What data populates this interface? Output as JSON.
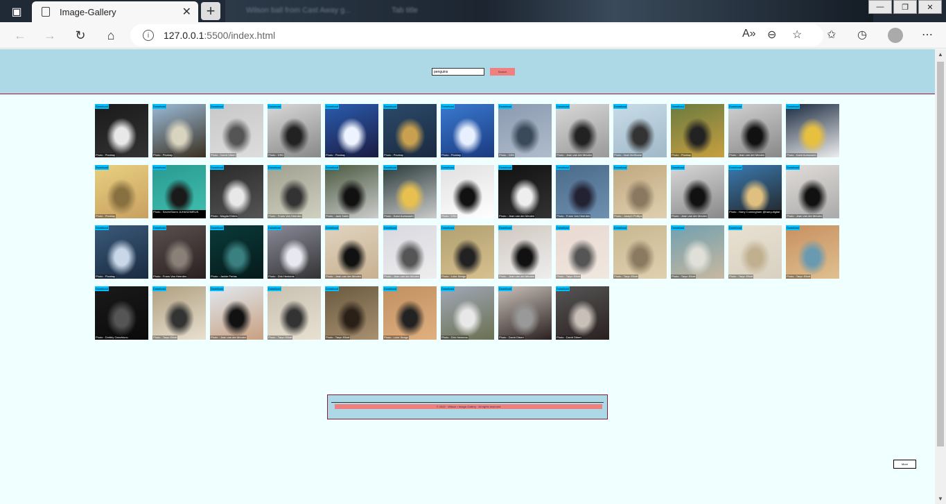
{
  "browser": {
    "tab_title": "Image-Gallery",
    "tab_close": "✕",
    "new_tab": "+",
    "bg_tab_1": "Wilson ball from Cast Away g...",
    "bg_tab_2": "Tab title",
    "url_host": "127.0.0.1",
    "url_path": ":5500/index.html",
    "win_min": "—",
    "win_max": "❐",
    "win_close": "✕"
  },
  "search": {
    "value": "penguins",
    "button_label": "Search"
  },
  "images": [
    {
      "download": "Download",
      "credit": "Photo : Pixabay",
      "colors": [
        "#1a1a1a",
        "#e8e8e8",
        "#333"
      ]
    },
    {
      "download": "Download",
      "credit": "Photo : Pixabay",
      "colors": [
        "#9bbbd8",
        "#d9d4c0",
        "#3a3020"
      ]
    },
    {
      "download": "Download",
      "credit": "Photo : David Dibert",
      "colors": [
        "#c8c8c8",
        "#555",
        "#ddd"
      ]
    },
    {
      "download": "Download",
      "credit": "Photo : DSD",
      "colors": [
        "#d8d8d8",
        "#222",
        "#888"
      ]
    },
    {
      "download": "Download",
      "credit": "Photo : Pixabay",
      "colors": [
        "#2a5db0",
        "#eef4ff",
        "#1a1a40"
      ]
    },
    {
      "download": "Download",
      "credit": "Photo : Pixabay",
      "colors": [
        "#2b4a6a",
        "#c8a050",
        "#1a2a40"
      ]
    },
    {
      "download": "Download",
      "credit": "Photo : Pixabay",
      "colors": [
        "#3a7ad0",
        "#e8f0ff",
        "#1a3a80"
      ]
    },
    {
      "download": "Download",
      "credit": "Photo : DSD",
      "colors": [
        "#8a9ab0",
        "#3a4a5a",
        "#b0bccc"
      ]
    },
    {
      "download": "Download",
      "credit": "Photo : Jean van der Meulen",
      "colors": [
        "#d8d8d8",
        "#222",
        "#999"
      ]
    },
    {
      "download": "Download",
      "credit": "Photo : Noel McShane",
      "colors": [
        "#c8dce8",
        "#333",
        "#a0b8c8"
      ]
    },
    {
      "download": "Download",
      "credit": "Photo : Pixabay",
      "colors": [
        "#6a7a40",
        "#222",
        "#c8a040"
      ]
    },
    {
      "download": "Download",
      "credit": "Photo : Jean van der Meulen",
      "colors": [
        "#d0d0d0",
        "#111",
        "#888"
      ]
    },
    {
      "download": "Download",
      "credit": "Photo : Kami Aumussen",
      "colors": [
        "#1a2a40",
        "#e8c040",
        "#eee"
      ]
    },
    {
      "download": "Download",
      "credit": "Photo : Pixabay",
      "colors": [
        "#e8d080",
        "#887040",
        "#c8a060"
      ]
    },
    {
      "download": "Download",
      "credit": "Photo : SevenStorm JUHASZIMRUS",
      "colors": [
        "#2a9a90",
        "#1a1a1a",
        "#40c0b0"
      ],
      "wide": true
    },
    {
      "download": "Download",
      "credit": "Photo : Magda Ehlers",
      "colors": [
        "#2a2a2a",
        "#e8e8e8",
        "#555"
      ]
    },
    {
      "download": "Download",
      "credit": "Photo : Frans Van Heerden",
      "colors": [
        "#a0a090",
        "#333",
        "#d0d0c0"
      ]
    },
    {
      "download": "Download",
      "credit": "Photo : Jack Salen",
      "colors": [
        "#4a5a40",
        "#111",
        "#ccc"
      ]
    },
    {
      "download": "Download",
      "credit": "Photo : Kami Aumussen",
      "colors": [
        "#2a3a3a",
        "#e8c050",
        "#ccc"
      ]
    },
    {
      "download": "Download",
      "credit": "Photo : DSD",
      "colors": [
        "#e0e0e0",
        "#111",
        "#fff"
      ]
    },
    {
      "download": "Download",
      "credit": "Photo : Jean van der Meulen",
      "colors": [
        "#111",
        "#eee",
        "#333"
      ]
    },
    {
      "download": "Download",
      "credit": "Photo : Frans Van Heerden",
      "colors": [
        "#4a6a8a",
        "#223",
        "#7090b0"
      ]
    },
    {
      "download": "Download",
      "credit": "Photo : Joseph Phillips",
      "colors": [
        "#c0a880",
        "#8a7860",
        "#e0d0b0"
      ]
    },
    {
      "download": "Download",
      "credit": "Photo : Jean van der Meulen",
      "colors": [
        "#d8d8d8",
        "#111",
        "#888"
      ]
    },
    {
      "download": "Download",
      "credit": "Photo : Harry Cunningham @harry.digital",
      "colors": [
        "#3a7ab0",
        "#e0c080",
        "#222"
      ],
      "wide": true
    },
    {
      "download": "Download",
      "credit": "Photo : Jean van der Meulen",
      "colors": [
        "#e0dcd8",
        "#111",
        "#aaa"
      ]
    },
    {
      "download": "Download",
      "credit": "Photo : Pixabay",
      "colors": [
        "#3a5a7a",
        "#c8d8e8",
        "#1a2a40"
      ]
    },
    {
      "download": "Download",
      "credit": "Photo : Frans Van Heerden",
      "colors": [
        "#5a5050",
        "#8a8078",
        "#2a2020"
      ]
    },
    {
      "download": "Download",
      "credit": "Photo : Jackie Pertas",
      "colors": [
        "#0a3a3a",
        "#3a8080",
        "#061a1a"
      ]
    },
    {
      "download": "Download",
      "credit": "Photo : Dirk Henkens",
      "colors": [
        "#8a8a9a",
        "#e8e8f0",
        "#333"
      ]
    },
    {
      "download": "Download",
      "credit": "Photo : Jean van der Meulen",
      "colors": [
        "#e0d4c0",
        "#111",
        "#c8b090"
      ]
    },
    {
      "download": "Download",
      "credit": "Photo : Jean van der Meulen",
      "colors": [
        "#d8d8e0",
        "#555",
        "#eee"
      ]
    },
    {
      "download": "Download",
      "credit": "Photo : Luke Seago",
      "colors": [
        "#b0a070",
        "#222",
        "#d8c090"
      ]
    },
    {
      "download": "Download",
      "credit": "Photo : Jean van der Meulen",
      "colors": [
        "#d0c8c0",
        "#111",
        "#eee"
      ]
    },
    {
      "download": "Download",
      "credit": "Photo : Taryn Elliott",
      "colors": [
        "#e8d8d0",
        "#555",
        "#f0e8e0"
      ]
    },
    {
      "download": "Download",
      "credit": "Photo : Taryn Elliott",
      "colors": [
        "#c8b890",
        "#8a7a60",
        "#e0d0b0"
      ]
    },
    {
      "download": "Download",
      "credit": "Photo : Taryn Elliott",
      "colors": [
        "#70a0b0",
        "#e0e0d8",
        "#c8b8a0"
      ]
    },
    {
      "download": "Download",
      "credit": "Photo : Taryn Elliott",
      "colors": [
        "#e8e0d0",
        "#c0b090",
        "#d8d0c0"
      ]
    },
    {
      "download": "Download",
      "credit": "Photo : Taryn Elliott",
      "colors": [
        "#c89060",
        "#6a9ab0",
        "#e0c090"
      ]
    },
    {
      "download": "Download",
      "credit": "Photo : Dmitriy Ganzhiunu",
      "colors": [
        "#1a1a1a",
        "#555",
        "#0a0a0a"
      ]
    },
    {
      "download": "Download",
      "credit": "Photo : Taryn Elliott",
      "colors": [
        "#b0a080",
        "#333",
        "#e8e0d0"
      ]
    },
    {
      "download": "Download",
      "credit": "Photo : Jean van der Meulen",
      "colors": [
        "#e0e8f0",
        "#111",
        "#c8a080"
      ]
    },
    {
      "download": "Download",
      "credit": "Photo : Taryn Elliott",
      "colors": [
        "#c8c0b0",
        "#333",
        "#e8e0d0"
      ]
    },
    {
      "download": "Download",
      "credit": "Photo : Taryn Elliott",
      "colors": [
        "#6a5a40",
        "#2a2018",
        "#a89070"
      ]
    },
    {
      "download": "Download",
      "credit": "Photo : Luke Seago",
      "colors": [
        "#c09060",
        "#222",
        "#e0b080"
      ]
    },
    {
      "download": "Download",
      "credit": "Photo : Dirk Henkens",
      "colors": [
        "#a0a8b8",
        "#e8e8e8",
        "#6a7050"
      ]
    },
    {
      "download": "Download",
      "credit": "Photo : David Dibert",
      "colors": [
        "#c8c0b8",
        "#999",
        "#2a2020"
      ]
    },
    {
      "download": "Download",
      "credit": "Photo : David Dibert",
      "colors": [
        "#555",
        "#c8c0b8",
        "#2a2020"
      ]
    }
  ],
  "footer": {
    "text": "© 2022 · Wilson • Image-Gallery · All rights reserved"
  },
  "more": {
    "label": "More"
  }
}
